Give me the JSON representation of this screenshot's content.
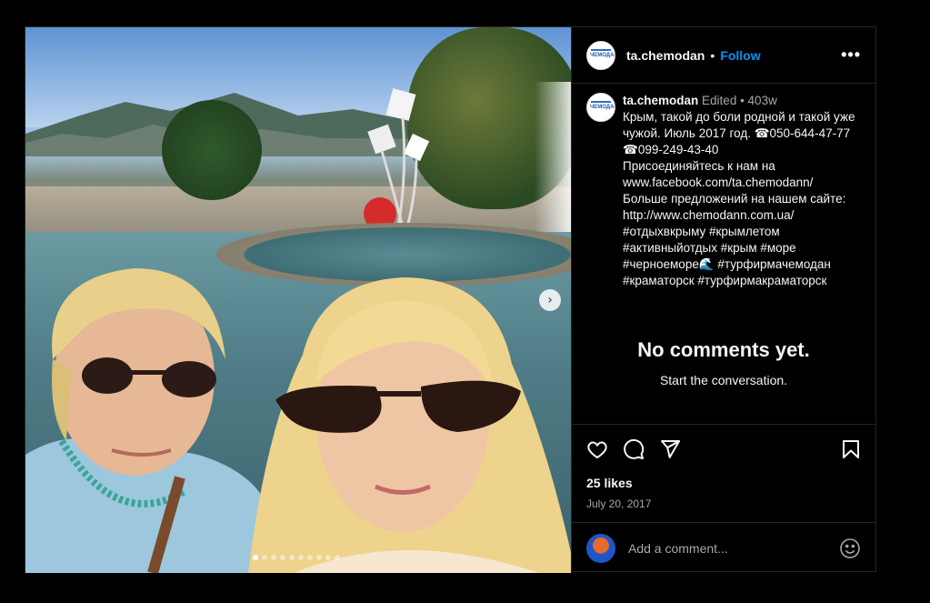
{
  "post": {
    "username": "ta.chemodan",
    "follow_label": "Follow",
    "more_label": "•••",
    "header_separator": "•",
    "avatar_text": "ЧЕМОДАН",
    "caption_username": "ta.chemodan",
    "caption_meta": "Edited • 403w",
    "caption_text": "Крым, такой до боли родной и такой уже чужой. Июль 2017 год. ☎050-644-47-77 ☎099-249-43-40\nПрисоединяйтесь к нам на www.facebook.com/ta.chemodann/\nБольше предложений на нашем сайте: http://www.chemodann.com.ua/\n#отдыхвкрыму #крымлетом #активныйотдых #крым #море #черноеморе🌊 #турфирмачемодан #краматорск #турфирмакраматорск",
    "no_comments_title": "No comments yet.",
    "no_comments_sub": "Start the conversation.",
    "likes": "25 likes",
    "date": "July 20, 2017",
    "comment_placeholder": "Add a comment...",
    "carousel_next_label": "›"
  },
  "carousel": {
    "total": 10,
    "current": 1
  },
  "icons": {
    "like": "heart-icon",
    "comment": "comment-icon",
    "share": "share-icon",
    "save": "bookmark-icon",
    "emoji": "emoji-icon",
    "next": "chevron-right-icon"
  },
  "colors": {
    "background": "#000000",
    "text": "#f5f5f5",
    "muted": "#a8a8a8",
    "follow": "#0095f6",
    "border": "#262626"
  }
}
